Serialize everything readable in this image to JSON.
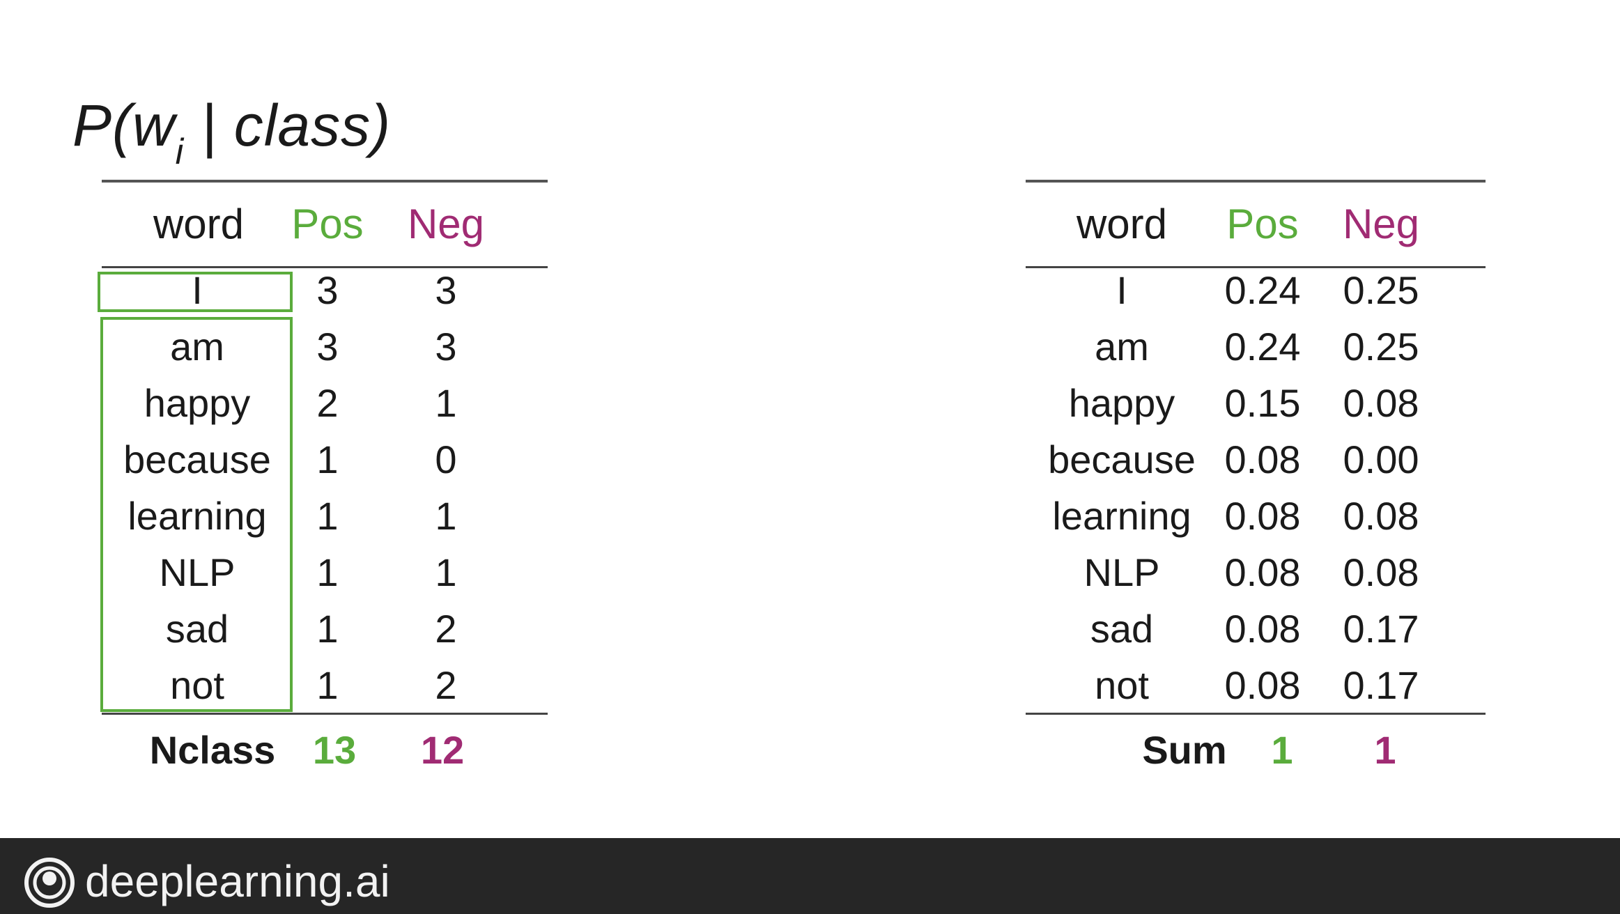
{
  "title": {
    "main": "P(w",
    "sub": "i",
    "rest": " | class)"
  },
  "left_table": {
    "headers": {
      "word": "word",
      "pos": "Pos",
      "neg": "Neg"
    },
    "rows": [
      {
        "word": "I",
        "pos": "3",
        "neg": "3"
      },
      {
        "word": "am",
        "pos": "3",
        "neg": "3"
      },
      {
        "word": "happy",
        "pos": "2",
        "neg": "1"
      },
      {
        "word": "because",
        "pos": "1",
        "neg": "0"
      },
      {
        "word": "learning",
        "pos": "1",
        "neg": "1"
      },
      {
        "word": "NLP",
        "pos": "1",
        "neg": "1"
      },
      {
        "word": "sad",
        "pos": "1",
        "neg": "2"
      },
      {
        "word": "not",
        "pos": "1",
        "neg": "2"
      }
    ],
    "footer": {
      "label": "Nclass",
      "pos": "13",
      "neg": "12"
    }
  },
  "right_table": {
    "headers": {
      "word": "word",
      "pos": "Pos",
      "neg": "Neg"
    },
    "rows": [
      {
        "word": "I",
        "pos": "0.24",
        "neg": "0.25"
      },
      {
        "word": "am",
        "pos": "0.24",
        "neg": "0.25"
      },
      {
        "word": "happy",
        "pos": "0.15",
        "neg": "0.08"
      },
      {
        "word": "because",
        "pos": "0.08",
        "neg": "0.00"
      },
      {
        "word": "learning",
        "pos": "0.08",
        "neg": "0.08"
      },
      {
        "word": "NLP",
        "pos": "0.08",
        "neg": "0.08"
      },
      {
        "word": "sad",
        "pos": "0.08",
        "neg": "0.17"
      },
      {
        "word": "not",
        "pos": "0.08",
        "neg": "0.17"
      }
    ],
    "footer": {
      "label": "Sum",
      "pos": "1",
      "neg": "1"
    }
  },
  "colors": {
    "pos": "#5aac3c",
    "neg": "#a02b73",
    "footer_bg": "#262626"
  },
  "brand": {
    "logo_icon": "deeplearning-logo-icon",
    "text": "deeplearning.ai"
  }
}
